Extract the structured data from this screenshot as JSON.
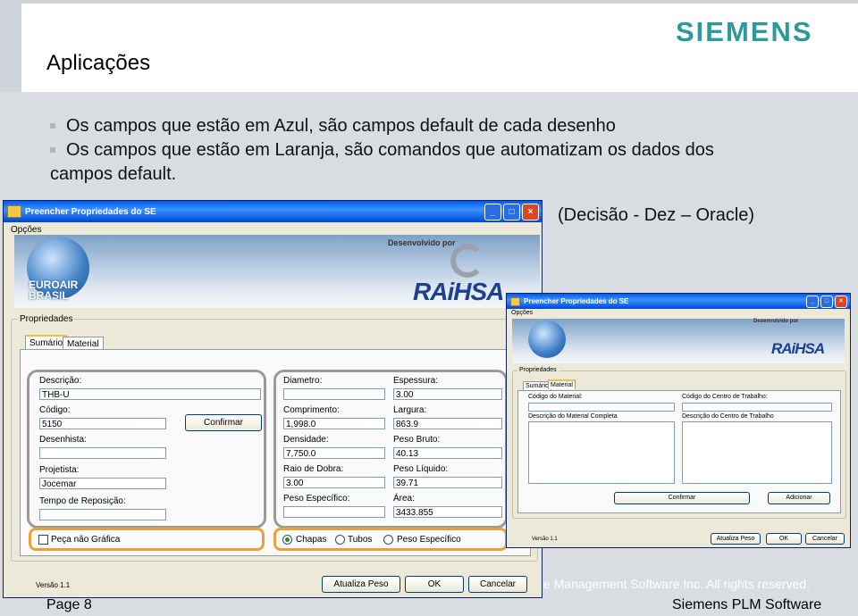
{
  "slide": {
    "title": "Aplicações",
    "logo": "SIEMENS",
    "bullets": [
      "Os campos que estão em Azul, são campos default de cada desenho",
      "Os campos que estão em Laranja, são comandos que automatizam os dados dos"
    ],
    "bullet_continuation": "campos default.",
    "side_note": "(Decisão - Dez – Oracle)",
    "copyright_fragment": "e Management Software Inc. All rights reserved.",
    "page": "Page 8",
    "footer": "Siemens PLM Software"
  },
  "window1": {
    "title": "Preencher Propriedades do SE",
    "controls": [
      "_",
      "□",
      "×"
    ],
    "menu": "Opções",
    "banner": {
      "brand_left": "EUROAIR BRASIL",
      "developed_by": "Desenvolvido por",
      "brand_right": "RAiHSA"
    },
    "group_label": "Propriedades",
    "tabs": [
      "Sumário",
      "Material"
    ],
    "fields": {
      "descricao_label": "Descrição:",
      "descricao_value": "THB-U",
      "codigo_label": "Código:",
      "codigo_value": "5150",
      "desenhista_label": "Desenhista:",
      "desenhista_value": "",
      "projetista_label": "Projetista:",
      "projetista_value": "Jocemar",
      "tempo_label": "Tempo de Reposição:",
      "tempo_value": "",
      "diametro_label": "Diametro:",
      "diametro_value": "",
      "espessura_label": "Espessura:",
      "espessura_value": "3.00",
      "comprimento_label": "Comprimento:",
      "comprimento_value": "1,998.0",
      "largura_label": "Largura:",
      "largura_value": "863.9",
      "densidade_label": "Densidade:",
      "densidade_value": "7,750.0",
      "peso_bruto_label": "Peso Bruto:",
      "peso_bruto_value": "40.13",
      "raio_label": "Raio de Dobra:",
      "raio_value": "3.00",
      "peso_liquido_label": "Peso Líquido:",
      "peso_liquido_value": "39.71",
      "peso_especifico_label": "Peso Específico:",
      "peso_especifico_value": "",
      "area_label": "Área:",
      "area_value": "3433.855"
    },
    "confirm_button": "Confirmar",
    "checkbox_label": "Peça não Gráfica",
    "radios": [
      "Chapas",
      "Tubos",
      "Peso Específico"
    ],
    "version": "Versão 1.1",
    "buttons": {
      "atualiza": "Atualiza Peso",
      "ok": "OK",
      "cancel": "Cancelar"
    }
  },
  "window2": {
    "title": "Preencher Propriedades do SE",
    "menu": "Opções",
    "developed_by": "Desenvolvido por",
    "brand_right": "RAiHSA",
    "group_label": "Propriedades",
    "tabs": [
      "Sumário",
      "Material"
    ],
    "labels": {
      "codigo_material": "Código do Material:",
      "codigo_centro": "Código do Centro de Trabalho:",
      "desc_material": "Descrição do Material Completa",
      "desc_centro": "Descrição do Centro de Trabalho"
    },
    "buttons": {
      "confirmar": "Confirmar",
      "adicionar": "Adicionar",
      "atualiza": "Atualiza Peso",
      "ok": "OK",
      "cancel": "Cancelar"
    },
    "version": "Versão 1.1"
  },
  "colors": {
    "siemens": "#2a9a9c",
    "highlight_orange": "#e8a23a",
    "highlight_grey": "#9a9a9a",
    "titlebar": "#0058ee"
  }
}
